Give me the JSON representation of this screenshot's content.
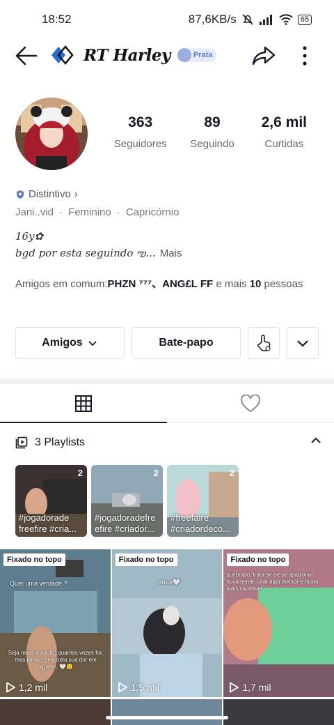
{
  "status_bar": {
    "time": "18:52",
    "network_speed": "87,6KB/s",
    "battery": "65"
  },
  "header": {
    "title": "RT Harley",
    "rank_badge": "Prata",
    "icons": [
      "back-arrow-icon",
      "share-icon",
      "more-vertical-icon"
    ]
  },
  "stats": [
    {
      "value": "363",
      "label": "Seguidores"
    },
    {
      "value": "89",
      "label": "Seguindo"
    },
    {
      "value": "2,6 mil",
      "label": "Curtidas"
    }
  ],
  "profile": {
    "badge_label": "Distintivo",
    "badge_chevron": "›",
    "info": [
      "Jani..vid",
      "·",
      "Feminino",
      "·",
      "Capricórnio"
    ],
    "bio_line1": "16y✿",
    "bio_line2": "bgd por esta seguindo ఌ...",
    "bio_more": "Mais",
    "mutual_prefix": "Amigos em comum:",
    "mutual_names": "PHZN ⁷⁷⁷、ANG£L FF",
    "mutual_mid": " e mais ",
    "mutual_count": "10",
    "mutual_suffix": " pessoas"
  },
  "actions": {
    "friends": "Amigos",
    "chat": "Bate-papo"
  },
  "playlists": {
    "header": "3 Playlists",
    "items": [
      {
        "count": "2",
        "title": "#jogadorade freefire #cria..."
      },
      {
        "count": "2",
        "title": "#jogadoradefre efire #criador..."
      },
      {
        "count": "2",
        "title": "#freefaire #criadordeco..."
      }
    ]
  },
  "videos": [
    {
      "pinned": "Fixado no topo",
      "views": "1,2 mil",
      "caption_top": "Quer uma verdade ?",
      "caption_mid": "Seja machucado(a) quantas vezes for, mas jamais desconta sua dor em alguém. 🤍🙂"
    },
    {
      "pinned": "Fixado no topo",
      "views": "1,5 mil",
      "caption_top": "Amor🤍",
      "caption_mid": ""
    },
    {
      "pinned": "Fixado no topo",
      "views": "1,7 mil",
      "caption_top": "quebrado, trata-se de se apaixonar novamente, criar algo melhor e muito mais saudável",
      "caption_mid": ""
    }
  ]
}
